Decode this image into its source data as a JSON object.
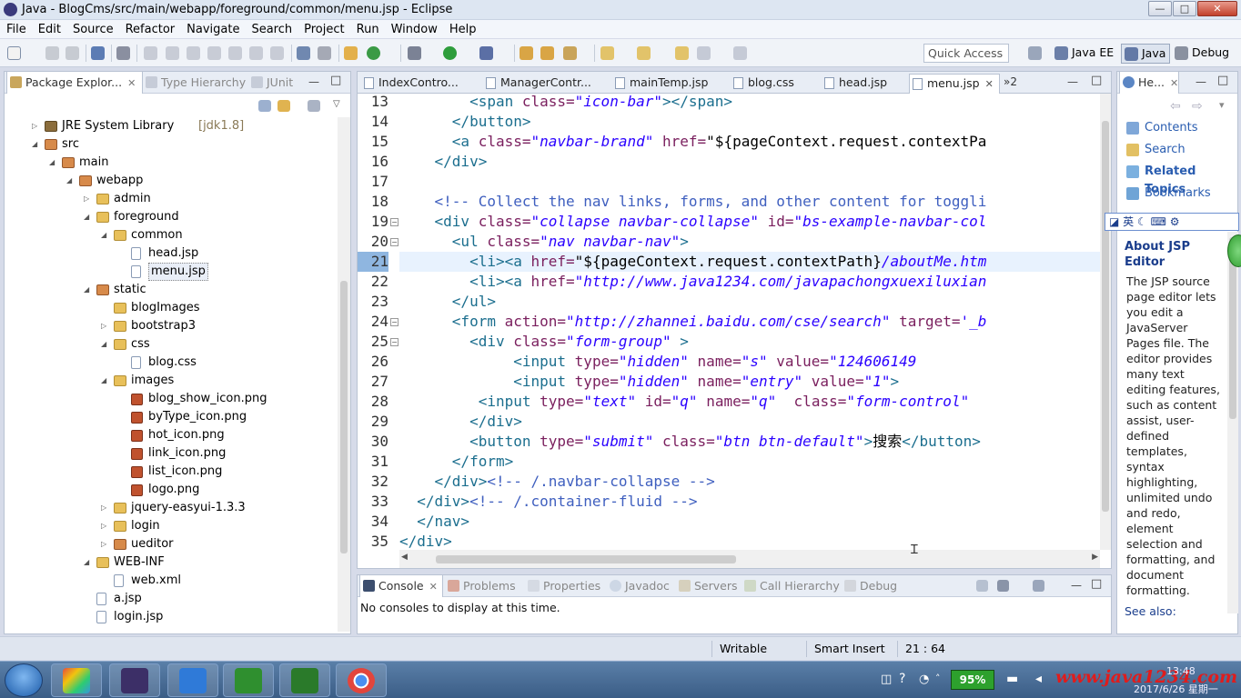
{
  "window": {
    "title": "Java - BlogCms/src/main/webapp/foreground/common/menu.jsp - Eclipse",
    "minimize": "—",
    "maximize": "□",
    "close": "✕"
  },
  "menu": [
    "File",
    "Edit",
    "Source",
    "Refactor",
    "Navigate",
    "Search",
    "Project",
    "Run",
    "Window",
    "Help"
  ],
  "toolbar": {
    "quick_access": "Quick Access",
    "perspectives": [
      "Java EE",
      "Java",
      "Debug"
    ]
  },
  "explorer": {
    "tabs": [
      "Package Explor...",
      "Type Hierarchy",
      "JUnit"
    ],
    "tree": [
      {
        "label": "JRE System Library",
        "suffix": "[jdk1.8]",
        "level": 0,
        "icon": "library-icon",
        "twisty": "▷"
      },
      {
        "label": "src",
        "level": 0,
        "icon": "package-folder-icon",
        "twisty": "◢"
      },
      {
        "label": "main",
        "level": 1,
        "icon": "package-folder-icon",
        "twisty": "◢"
      },
      {
        "label": "webapp",
        "level": 2,
        "icon": "package-folder-icon",
        "twisty": "◢"
      },
      {
        "label": "admin",
        "level": 3,
        "icon": "folder-icon",
        "twisty": "▷"
      },
      {
        "label": "foreground",
        "level": 3,
        "icon": "folder-icon",
        "twisty": "◢"
      },
      {
        "label": "common",
        "level": 4,
        "icon": "folder-icon",
        "twisty": "◢"
      },
      {
        "label": "head.jsp",
        "level": 5,
        "icon": "file-icon",
        "twisty": ""
      },
      {
        "label": "menu.jsp",
        "level": 5,
        "icon": "file-icon",
        "twisty": "",
        "selected": true
      },
      {
        "label": "static",
        "level": 3,
        "icon": "package-folder-icon",
        "twisty": "◢"
      },
      {
        "label": "blogImages",
        "level": 4,
        "icon": "folder-icon",
        "twisty": ""
      },
      {
        "label": "bootstrap3",
        "level": 4,
        "icon": "folder-icon",
        "twisty": "▷"
      },
      {
        "label": "css",
        "level": 4,
        "icon": "folder-icon",
        "twisty": "◢"
      },
      {
        "label": "blog.css",
        "level": 5,
        "icon": "file-icon",
        "twisty": ""
      },
      {
        "label": "images",
        "level": 4,
        "icon": "folder-icon",
        "twisty": "◢"
      },
      {
        "label": "blog_show_icon.png",
        "level": 5,
        "icon": "image-icon",
        "twisty": ""
      },
      {
        "label": "byType_icon.png",
        "level": 5,
        "icon": "image-icon",
        "twisty": ""
      },
      {
        "label": "hot_icon.png",
        "level": 5,
        "icon": "image-icon",
        "twisty": ""
      },
      {
        "label": "link_icon.png",
        "level": 5,
        "icon": "image-icon",
        "twisty": ""
      },
      {
        "label": "list_icon.png",
        "level": 5,
        "icon": "image-icon",
        "twisty": ""
      },
      {
        "label": "logo.png",
        "level": 5,
        "icon": "image-icon",
        "twisty": ""
      },
      {
        "label": "jquery-easyui-1.3.3",
        "level": 4,
        "icon": "folder-icon",
        "twisty": "▷"
      },
      {
        "label": "login",
        "level": 4,
        "icon": "folder-icon",
        "twisty": "▷"
      },
      {
        "label": "ueditor",
        "level": 4,
        "icon": "package-folder-icon",
        "twisty": "▷"
      },
      {
        "label": "WEB-INF",
        "level": 3,
        "icon": "folder-icon",
        "twisty": "◢"
      },
      {
        "label": "web.xml",
        "level": 4,
        "icon": "file-icon",
        "twisty": ""
      },
      {
        "label": "a.jsp",
        "level": 3,
        "icon": "file-icon",
        "twisty": ""
      },
      {
        "label": "login.jsp",
        "level": 3,
        "icon": "file-icon",
        "twisty": ""
      }
    ]
  },
  "editor": {
    "tabs": [
      "IndexContro...",
      "ManagerContr...",
      "mainTemp.jsp",
      "blog.css",
      "head.jsp",
      "menu.jsp"
    ],
    "active_tab": "menu.jsp",
    "overflow": "»2",
    "current_line": 21,
    "lines": [
      {
        "n": "13",
        "fold": "",
        "segs": [
          [
            "plain",
            "        "
          ],
          [
            "tag",
            "<span "
          ],
          [
            "attr",
            "class="
          ],
          [
            "str",
            "\"icon-bar\""
          ],
          [
            "tag",
            "></span>"
          ]
        ]
      },
      {
        "n": "14",
        "fold": "",
        "segs": [
          [
            "plain",
            "      "
          ],
          [
            "tag",
            "</button>"
          ]
        ]
      },
      {
        "n": "15",
        "fold": "",
        "segs": [
          [
            "plain",
            "      "
          ],
          [
            "tag",
            "<a "
          ],
          [
            "attr",
            "class="
          ],
          [
            "str",
            "\"navbar-brand\""
          ],
          [
            "plain",
            " "
          ],
          [
            "attr",
            "href="
          ],
          [
            "plain",
            "\"${pageContext.request.contextPa"
          ]
        ]
      },
      {
        "n": "16",
        "fold": "",
        "segs": [
          [
            "plain",
            "    "
          ],
          [
            "tag",
            "</div>"
          ]
        ]
      },
      {
        "n": "17",
        "fold": "",
        "segs": [
          [
            "plain",
            ""
          ]
        ]
      },
      {
        "n": "18",
        "fold": "",
        "segs": [
          [
            "plain",
            "    "
          ],
          [
            "cmt",
            "<!-- Collect the nav links, forms, and other content for toggli"
          ]
        ]
      },
      {
        "n": "19",
        "fold": "⊖",
        "segs": [
          [
            "plain",
            "    "
          ],
          [
            "tag",
            "<div "
          ],
          [
            "attr",
            "class="
          ],
          [
            "str",
            "\"collapse navbar-collapse\""
          ],
          [
            "plain",
            " "
          ],
          [
            "attr",
            "id="
          ],
          [
            "str",
            "\"bs-example-navbar-col"
          ]
        ]
      },
      {
        "n": "20",
        "fold": "⊖",
        "segs": [
          [
            "plain",
            "      "
          ],
          [
            "tag",
            "<ul "
          ],
          [
            "attr",
            "class="
          ],
          [
            "str",
            "\"nav navbar-nav\""
          ],
          [
            "tag",
            ">"
          ]
        ]
      },
      {
        "n": "21",
        "fold": "",
        "segs": [
          [
            "plain",
            "        "
          ],
          [
            "tag",
            "<li><a "
          ],
          [
            "attr",
            "href="
          ],
          [
            "plain",
            "\"${pageContext.request.contextPath}"
          ],
          [
            "str",
            "/aboutMe.htm"
          ]
        ]
      },
      {
        "n": "22",
        "fold": "",
        "segs": [
          [
            "plain",
            "        "
          ],
          [
            "tag",
            "<li><a "
          ],
          [
            "attr",
            "href="
          ],
          [
            "str",
            "\"http://www.java1234.com/javapachongxuexiluxian"
          ]
        ]
      },
      {
        "n": "23",
        "fold": "",
        "segs": [
          [
            "plain",
            "      "
          ],
          [
            "tag",
            "</ul>"
          ]
        ]
      },
      {
        "n": "24",
        "fold": "⊖",
        "segs": [
          [
            "plain",
            "      "
          ],
          [
            "tag",
            "<form "
          ],
          [
            "attr",
            "action="
          ],
          [
            "str",
            "\"http://zhannei.baidu.com/cse/search\""
          ],
          [
            "plain",
            " "
          ],
          [
            "attr",
            "target="
          ],
          [
            "str",
            "'_b"
          ]
        ]
      },
      {
        "n": "25",
        "fold": "⊖",
        "segs": [
          [
            "plain",
            "        "
          ],
          [
            "tag",
            "<div "
          ],
          [
            "attr",
            "class="
          ],
          [
            "str",
            "\"form-group\""
          ],
          [
            "plain",
            " "
          ],
          [
            "tag",
            ">"
          ]
        ]
      },
      {
        "n": "26",
        "fold": "",
        "segs": [
          [
            "plain",
            "             "
          ],
          [
            "tag",
            "<input "
          ],
          [
            "attr",
            "type="
          ],
          [
            "str",
            "\"hidden\""
          ],
          [
            "plain",
            " "
          ],
          [
            "attr",
            "name="
          ],
          [
            "str",
            "\"s\""
          ],
          [
            "plain",
            " "
          ],
          [
            "attr",
            "value="
          ],
          [
            "str",
            "\"124606149"
          ]
        ]
      },
      {
        "n": "27",
        "fold": "",
        "segs": [
          [
            "plain",
            "             "
          ],
          [
            "tag",
            "<input "
          ],
          [
            "attr",
            "type="
          ],
          [
            "str",
            "\"hidden\""
          ],
          [
            "plain",
            " "
          ],
          [
            "attr",
            "name="
          ],
          [
            "str",
            "\"entry\""
          ],
          [
            "plain",
            " "
          ],
          [
            "attr",
            "value="
          ],
          [
            "str",
            "\"1\""
          ],
          [
            "tag",
            ">"
          ]
        ]
      },
      {
        "n": "28",
        "fold": "",
        "segs": [
          [
            "plain",
            "         "
          ],
          [
            "tag",
            "<input "
          ],
          [
            "attr",
            "type="
          ],
          [
            "str",
            "\"text\""
          ],
          [
            "plain",
            " "
          ],
          [
            "attr",
            "id="
          ],
          [
            "str",
            "\"q\""
          ],
          [
            "plain",
            " "
          ],
          [
            "attr",
            "name="
          ],
          [
            "str",
            "\"q\""
          ],
          [
            "plain",
            "  "
          ],
          [
            "attr",
            "class="
          ],
          [
            "str",
            "\"form-control\""
          ]
        ]
      },
      {
        "n": "29",
        "fold": "",
        "segs": [
          [
            "plain",
            "        "
          ],
          [
            "tag",
            "</div>"
          ]
        ]
      },
      {
        "n": "30",
        "fold": "",
        "segs": [
          [
            "plain",
            "        "
          ],
          [
            "tag",
            "<button "
          ],
          [
            "attr",
            "type="
          ],
          [
            "str",
            "\"submit\""
          ],
          [
            "plain",
            " "
          ],
          [
            "attr",
            "class="
          ],
          [
            "str",
            "\"btn btn-default\""
          ],
          [
            "tag",
            ">"
          ],
          [
            "plain",
            "搜索"
          ],
          [
            "tag",
            "</button>"
          ]
        ]
      },
      {
        "n": "31",
        "fold": "",
        "segs": [
          [
            "plain",
            "      "
          ],
          [
            "tag",
            "</form>"
          ]
        ]
      },
      {
        "n": "32",
        "fold": "",
        "segs": [
          [
            "plain",
            "    "
          ],
          [
            "tag",
            "</div>"
          ],
          [
            "cmt",
            "<!-- /.navbar-collapse -->"
          ]
        ]
      },
      {
        "n": "33",
        "fold": "",
        "segs": [
          [
            "plain",
            "  "
          ],
          [
            "tag",
            "</div>"
          ],
          [
            "cmt",
            "<!-- /.container-fluid -->"
          ]
        ]
      },
      {
        "n": "34",
        "fold": "",
        "segs": [
          [
            "plain",
            "  "
          ],
          [
            "tag",
            "</nav>"
          ]
        ]
      },
      {
        "n": "35",
        "fold": "",
        "segs": [
          [
            "tag",
            "</div>"
          ]
        ]
      }
    ]
  },
  "console": {
    "tabs": [
      "Console",
      "Problems",
      "Properties",
      "Javadoc",
      "Servers",
      "Call Hierarchy",
      "Debug"
    ],
    "message": "No consoles to display at this time."
  },
  "help": {
    "tab": "He...",
    "links": [
      "Contents",
      "Search",
      "Related Topics",
      "Bookmarks"
    ],
    "ime": "英",
    "heading": "About JSP Editor",
    "body": "The JSP source page editor lets you edit a JavaServer Pages file. The editor provides many text editing features, such as content assist, user-defined templates, syntax highlighting, unlimited undo and redo, element selection and formatting, and document formatting.",
    "see_also": "See also:"
  },
  "status": {
    "writable": "Writable",
    "insert_mode": "Smart Insert",
    "position": "21 : 64"
  },
  "taskbar": {
    "battery": "95%",
    "watermark": "www.java1234.com",
    "clock_time": "13:48",
    "clock_date": "2017/6/26 星期一"
  }
}
